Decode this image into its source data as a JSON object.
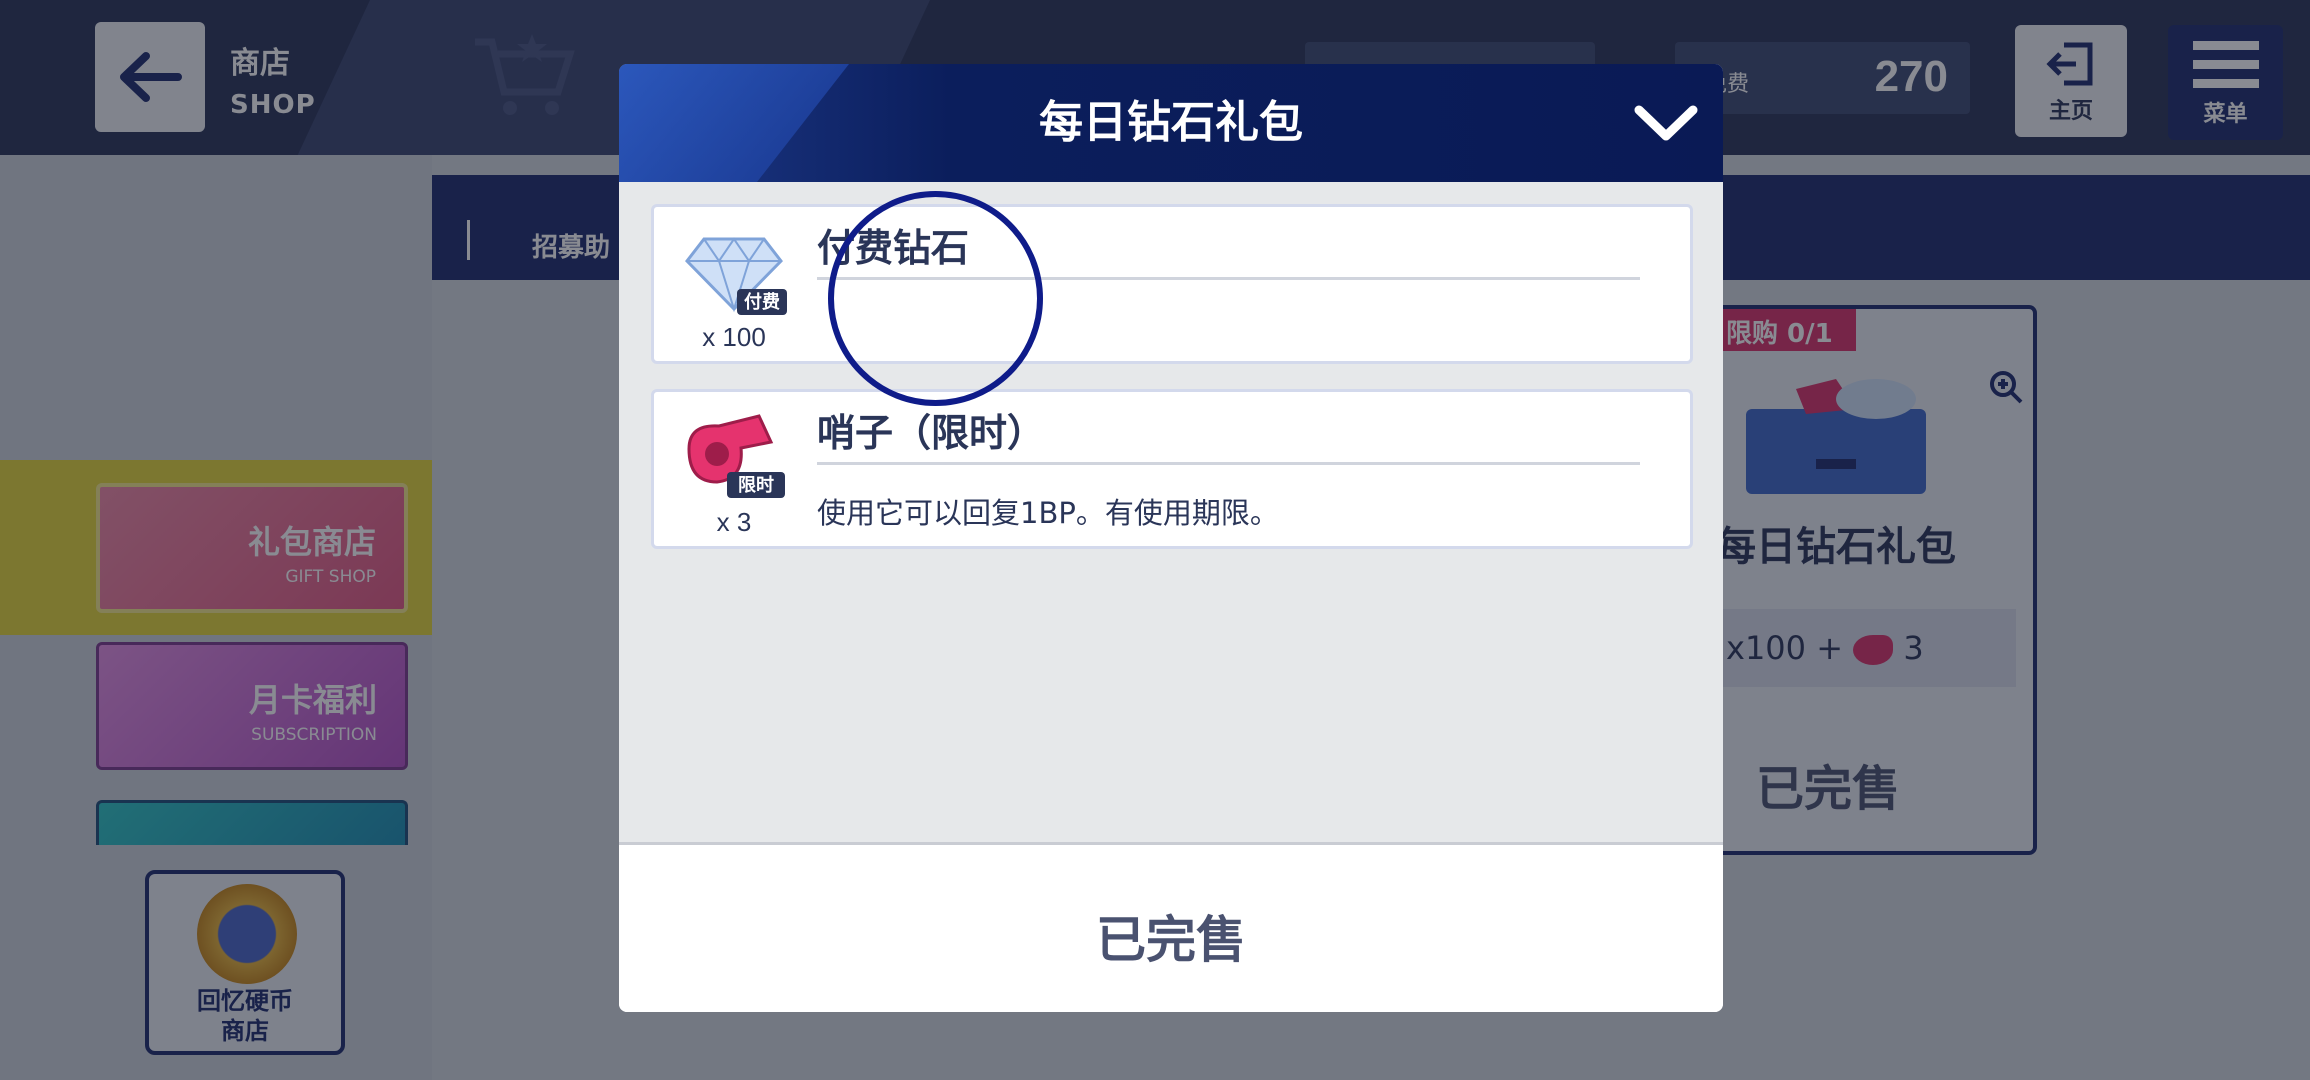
{
  "header": {
    "title": "商店",
    "subtitle": "SHOP",
    "currency_label": "免费",
    "currency_value": "270",
    "home_label": "主页",
    "menu_label": "菜单"
  },
  "subnav": {
    "tab_label": "招募助"
  },
  "sidebar": {
    "items": [
      {
        "title": "礼包商店",
        "subtitle": "GIFT SHOP"
      },
      {
        "title": "月卡福利",
        "subtitle": "SUBSCRIPTION"
      }
    ],
    "coin_shop": {
      "line1": "回忆硬币",
      "line2": "商店"
    }
  },
  "product_card": {
    "limit_badge": "限购 0/1",
    "name": "每日钻石礼包",
    "items_text": "x100 + ",
    "items_text_2": "3",
    "status": "已完售"
  },
  "modal": {
    "title": "每日钻石礼包",
    "items": [
      {
        "name": "付费钻石",
        "qty": "x 100",
        "badge": "付费",
        "icon": "diamond-icon",
        "description": ""
      },
      {
        "name": "哨子（限时）",
        "qty": "x 3",
        "badge": "限时",
        "icon": "whistle-icon",
        "description": "使用它可以回复1BP。有使用期限。"
      }
    ],
    "footer_button": "已完售"
  },
  "colors": {
    "navy": "#1e2c6e",
    "header_bg": "#0a1a55",
    "accent_pink": "#d8336a",
    "highlight_yellow": "#e4d73a"
  }
}
